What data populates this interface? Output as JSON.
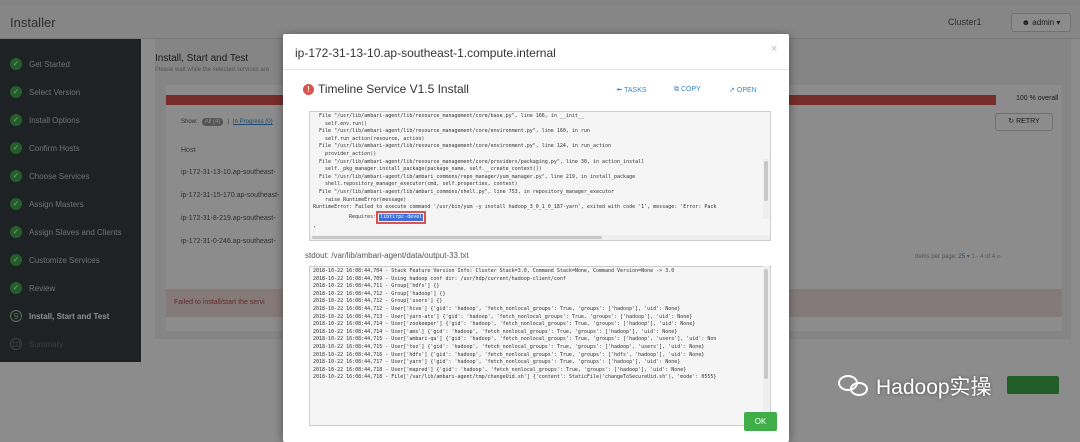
{
  "app": {
    "title": "Installer",
    "cluster": "Cluster1",
    "user_label": "admin"
  },
  "steps": [
    {
      "label": "Get Started",
      "state": "done"
    },
    {
      "label": "Select Version",
      "state": "done"
    },
    {
      "label": "Install Options",
      "state": "done"
    },
    {
      "label": "Confirm Hosts",
      "state": "done"
    },
    {
      "label": "Choose Services",
      "state": "done"
    },
    {
      "label": "Assign Masters",
      "state": "done"
    },
    {
      "label": "Assign Slaves and Clients",
      "state": "done"
    },
    {
      "label": "Customize Services",
      "state": "done"
    },
    {
      "label": "Review",
      "state": "done"
    },
    {
      "label": "Install, Start and Test",
      "state": "current",
      "num": "9"
    },
    {
      "label": "Summary",
      "state": "future",
      "num": "10"
    }
  ],
  "content": {
    "title": "Install, Start and Test",
    "subtitle": "Please wait while the selected services are",
    "progress_percent": 100,
    "overall_label": "100 % overall",
    "show_label": "Show:",
    "all_pill": "All (4)",
    "in_progress_link": "In Progress (0)",
    "retry_label": "RETRY",
    "host_header": "Host",
    "hosts": [
      "ip-172-31-13-10.ap-southeast-",
      "ip-172-31-15-170.ap-southeast-",
      "ip-172-31-8-219.ap-southeast-",
      "ip-172-31-0-246.ap-southeast-"
    ],
    "pager": {
      "label": "Items per page:",
      "value": "25",
      "range": "1 - 4 of 4"
    },
    "failed_text": "Failed to install/start the servi"
  },
  "modal": {
    "title": "ip-172-31-13-10.ap-southeast-1.compute.internal",
    "close": "×",
    "service_title": "Timeline Service V1.5 Install",
    "tasks_label": "TASKS",
    "copy_label": "COPY",
    "open_label": "OPEN",
    "stderr_lines": [
      "  File \"/usr/lib/ambari-agent/lib/resource_management/core/base.py\", line 166, in __init__",
      "    self.env.run()",
      "  File \"/usr/lib/ambari-agent/lib/resource_management/core/environment.py\", line 160, in run",
      "    self.run_action(resource, action)",
      "  File \"/usr/lib/ambari-agent/lib/resource_management/core/environment.py\", line 124, in run_action",
      "    provider_action()",
      "  File \"/usr/lib/ambari-agent/lib/resource_management/core/providers/packaging.py\", line 30, in action_install",
      "    self._pkg_manager.install_package(package_name, self.__create_context())",
      "  File \"/usr/lib/ambari-agent/lib/ambari_commons/repo_manager/yum_manager.py\", line 219, in install_package",
      "    shell.repository_manager_executor(cmd, self.properties, context)",
      "  File \"/usr/lib/ambari-agent/lib/ambari_commons/shell.py\", line 753, in repository_manager_executor",
      "    raise RuntimeError(message)",
      "RuntimeError: Failed to execute command '/usr/bin/yum -y install hadoop_3_0_1_0_187-yarn', exited with code '1', message: 'Error: Pack"
    ],
    "requires_prefix": "Requires:",
    "requires_value": "libtirpc-devel",
    "stderr_tail": ",",
    "stdout_label": "stdout:  /var/lib/ambari-agent/data/output-33.txt",
    "stdout_lines": [
      "2018-10-22 16:08:44,704 - Stack Feature Version Info: Cluster Stack=3.0, Command Stack=None, Command Version=None -> 3.0",
      "2018-10-22 16:08:44,709 - Using hadoop conf dir: /usr/hdp/current/hadoop-client/conf",
      "2018-10-22 16:08:44,711 - Group['hdfs'] {}",
      "2018-10-22 16:08:44,712 - Group['hadoop'] {}",
      "2018-10-22 16:08:44,712 - Group['users'] {}",
      "2018-10-22 16:08:44,712 - User['hive'] {'gid': 'hadoop', 'fetch_nonlocal_groups': True, 'groups': ['hadoop'], 'uid': None}",
      "2018-10-22 16:08:44,713 - User['yarn-ats'] {'gid': 'hadoop', 'fetch_nonlocal_groups': True, 'groups': ['hadoop'], 'uid': None}",
      "2018-10-22 16:08:44,714 - User['zookeeper'] {'gid': 'hadoop', 'fetch_nonlocal_groups': True, 'groups': ['hadoop'], 'uid': None}",
      "2018-10-22 16:08:44,714 - User['ams'] {'gid': 'hadoop', 'fetch_nonlocal_groups': True, 'groups': ['hadoop'], 'uid': None}",
      "2018-10-22 16:08:44,715 - User['ambari-qa'] {'gid': 'hadoop', 'fetch_nonlocal_groups': True, 'groups': ['hadoop', 'users'], 'uid': Non",
      "2018-10-22 16:08:44,715 - User['tez'] {'gid': 'hadoop', 'fetch_nonlocal_groups': True, 'groups': ['hadoop', 'users'], 'uid': None}",
      "2018-10-22 16:08:44,716 - User['hdfs'] {'gid': 'hadoop', 'fetch_nonlocal_groups': True, 'groups': ['hdfs', 'hadoop'], 'uid': None}",
      "2018-10-22 16:08:44,717 - User['yarn'] {'gid': 'hadoop', 'fetch_nonlocal_groups': True, 'groups': ['hadoop'], 'uid': None}",
      "2018-10-22 16:08:44,718 - User['mapred'] {'gid': 'hadoop', 'fetch_nonlocal_groups': True, 'groups': ['hadoop'], 'uid': None}",
      "2018-10-22 16:08:44,718 - File['/var/lib/ambari-agent/tmp/changeUid.sh'] {'content': StaticFile('changeToSecureUid.sh'), 'mode': 0555}"
    ],
    "ok_label": "OK"
  },
  "watermark": {
    "text": "Hadoop实操",
    "icon": "wechat-icon"
  },
  "icons": {
    "done": "check-icon",
    "warning": "exclamation-icon",
    "tasks": "arrow-left-icon",
    "copy": "copy-icon",
    "open": "external-link-icon",
    "user": "user-icon"
  },
  "colors": {
    "success": "#3fae49",
    "danger": "#d9534f",
    "link": "#3a87c8",
    "sidebar": "#3a3f44",
    "highlight": "#3e6fd8"
  }
}
